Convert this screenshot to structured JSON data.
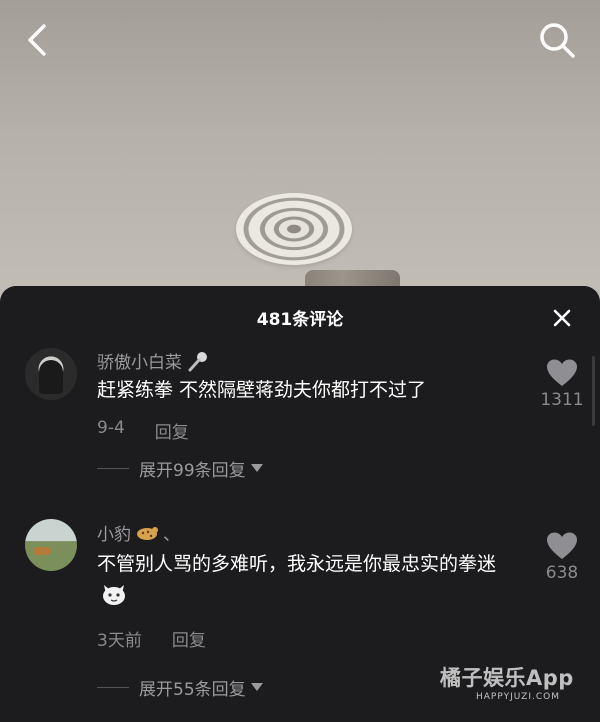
{
  "topbar": {
    "back_icon": "chevron-left-icon",
    "search_icon": "search-icon"
  },
  "sheet": {
    "title": "481条评论",
    "close_icon": "close-icon"
  },
  "comments": [
    {
      "username": "骄傲小白菜",
      "badge_icon": "microphone-icon",
      "text": "赶紧练拳 不然隔壁蒋劲夫你都打不过了",
      "date": "9-4",
      "reply_label": "回复",
      "likes": "1311",
      "expand_label": "展开99条回复"
    },
    {
      "username": "小豹",
      "badge_icon": "leopard-emoji",
      "username_suffix": "、",
      "text": "不管别人骂的多难听，我永远是你最忠实的拳迷",
      "text_emoji": "cat-emoji",
      "date": "3天前",
      "reply_label": "回复",
      "likes": "638",
      "expand_label": "展开55条回复"
    }
  ],
  "watermark": {
    "logo": "橘子娱乐App",
    "url": "HAPPYJUZI.COM"
  },
  "colors": {
    "sheet_bg": "#1c1c1e",
    "text_primary": "#ffffff",
    "text_secondary": "#8a8a8e"
  }
}
